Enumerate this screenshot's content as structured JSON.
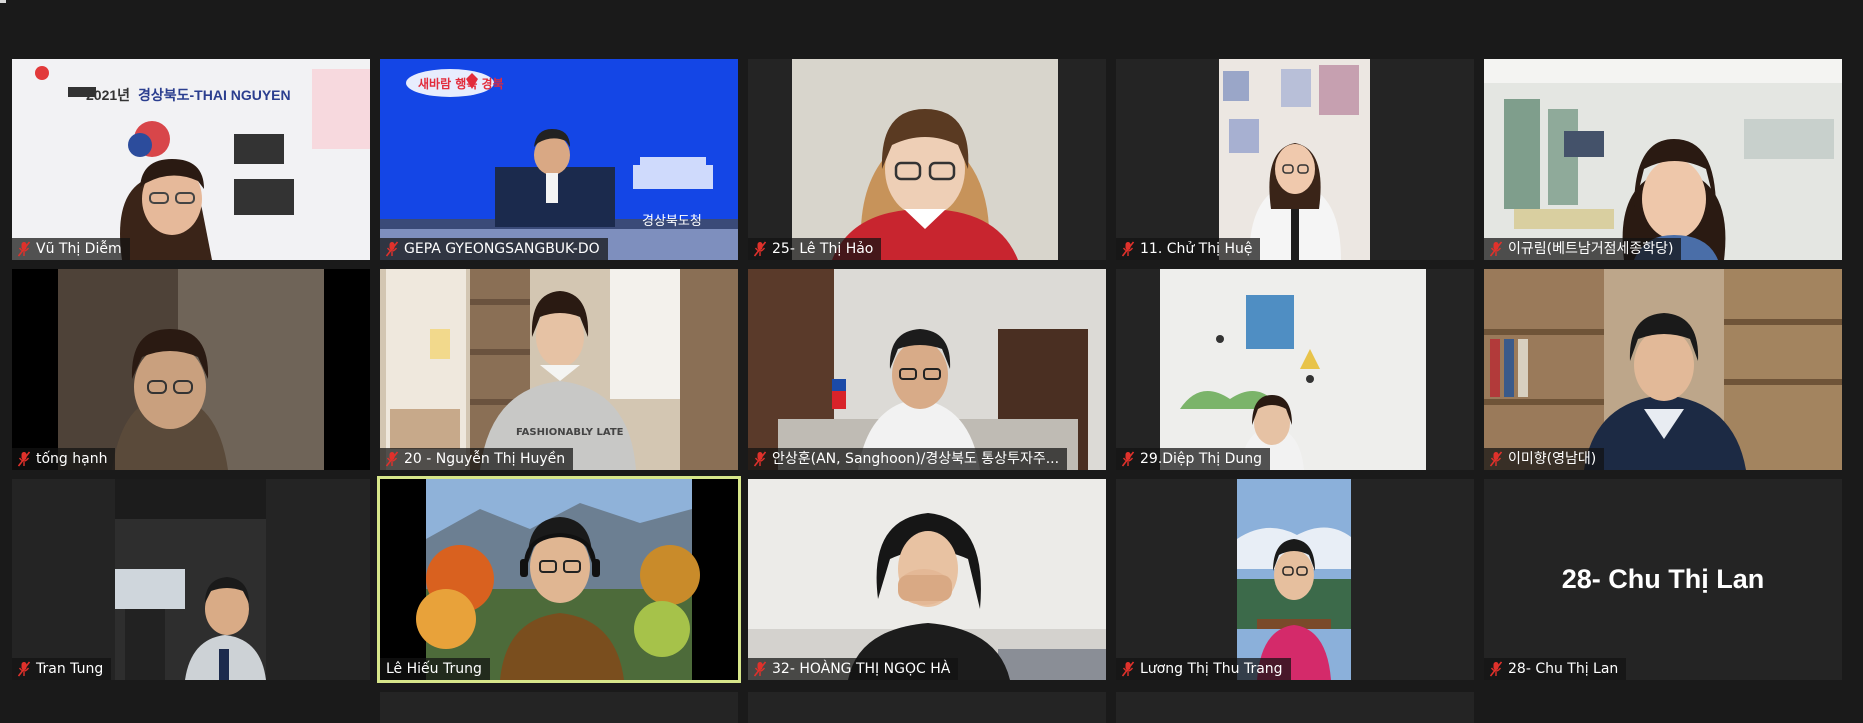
{
  "window": {
    "app": "Zoom",
    "view": "Gallery View"
  },
  "tiles": [
    {
      "name": "Vũ Thị Diễm",
      "muted": true,
      "banner_year": "2021년",
      "banner_title": "경상북도-THAI NGUYEN"
    },
    {
      "name": "GEPA GYEONGSANGBUK-DO",
      "muted": true,
      "slogan": "새바람 행복 경북",
      "org_label": "경상북도청"
    },
    {
      "name": "25- Lê Thị Hảo",
      "muted": true
    },
    {
      "name": "11. Chử Thị Huệ",
      "muted": true
    },
    {
      "name": "이규림(베트남거점세종학당)",
      "muted": true
    },
    {
      "name": "tống hạnh",
      "muted": true
    },
    {
      "name": "20 - Nguyễn Thị Huyền",
      "muted": true,
      "shirt_text": "FASHIONABLY LATE"
    },
    {
      "name": "안상훈(AN, Sanghoon)/경상북도 통상투자주...",
      "muted": true
    },
    {
      "name": "29.Diệp Thị Dung",
      "muted": true
    },
    {
      "name": "이미향(영남대)",
      "muted": true
    },
    {
      "name": "Tran Tung",
      "muted": true
    },
    {
      "name": "Lê Hiếu Trung",
      "muted": false,
      "active_speaker": true
    },
    {
      "name": "32- HOÀNG THỊ NGỌC HÀ",
      "muted": true
    },
    {
      "name": "Lương Thị Thu Trang",
      "muted": true
    },
    {
      "name": "28- Chu Thị Lan",
      "muted": true,
      "video_off": true,
      "display_name": "28- Chu Thị Lan"
    }
  ],
  "colors": {
    "background": "#1a1a1a",
    "tile": "#242424",
    "active_border": "#d7e68a",
    "mute_icon": "#e0312b"
  }
}
